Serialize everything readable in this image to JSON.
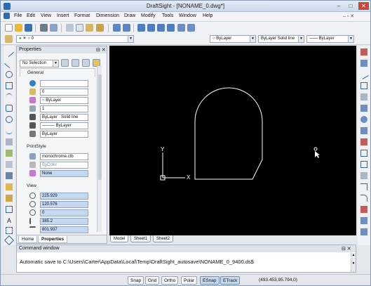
{
  "window": {
    "title": "DraftSight - [NONAME_0.dwg*]",
    "min": "–",
    "max": "□",
    "close": "✕"
  },
  "menu": [
    "File",
    "Edit",
    "View",
    "Insert",
    "Format",
    "Dimension",
    "Draw",
    "Modify",
    "Tools",
    "Window",
    "Help"
  ],
  "toolbar2": {
    "layer_value": "0",
    "color_value": "ByLayer",
    "linestyle_value": "ByLayer",
    "linestyle_type": "Solid line",
    "lineweight_value": "ByLayer"
  },
  "properties": {
    "header": "Properties",
    "selection": "No Selection",
    "general_label": "General",
    "general_rows": [
      "",
      "0",
      "ByLayer",
      "1",
      "ByLayer",
      "Solid line",
      "ByLayer",
      "ByLayer"
    ],
    "printstyle_label": "PrintStyle",
    "printstyle_rows": [
      "monochrome.ctb",
      "ByColor",
      "None"
    ],
    "view_label": "View",
    "view_rows": [
      "225.929",
      "120.576",
      "0",
      "385.2",
      "801.937"
    ],
    "tabs": [
      "Home",
      "Properties"
    ]
  },
  "layout_tabs": [
    "Model",
    "Sheet1",
    "Sheet2"
  ],
  "ucs": {
    "x_label": "X",
    "y_label": "Y"
  },
  "command": {
    "header": "Command window",
    "text": "Automatic save to C:\\Users\\Carter\\AppData\\Local\\Temp\\DraftSight_autosave\\NONAME_0_9400.ds$"
  },
  "status": {
    "buttons": [
      "Snap",
      "Grid",
      "Ortho",
      "Polar",
      "ESnap",
      "ETrack"
    ],
    "coords": "(493.453,95.794,0)"
  }
}
